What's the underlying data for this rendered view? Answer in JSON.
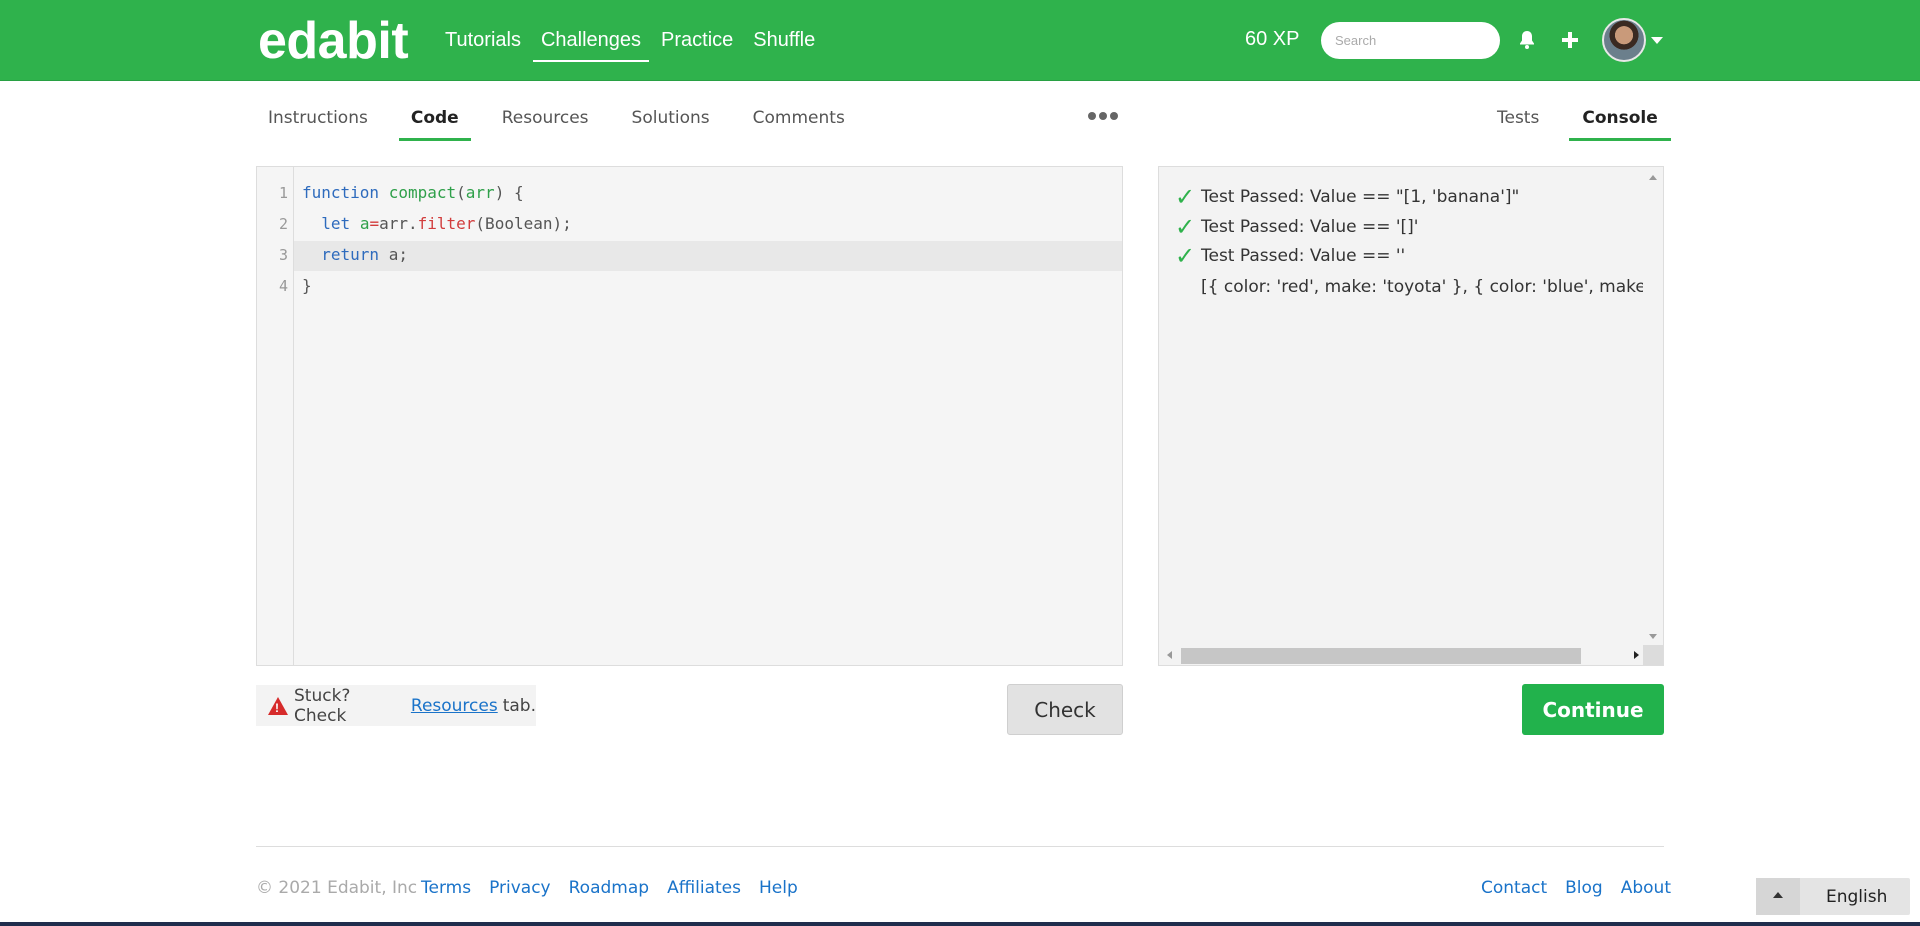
{
  "header": {
    "logo": "edabit",
    "nav": [
      "Tutorials",
      "Challenges",
      "Practice",
      "Shuffle"
    ],
    "active_nav": "Challenges",
    "xp": "60 XP",
    "search_placeholder": "Search"
  },
  "tabs": {
    "left": [
      "Instructions",
      "Code",
      "Resources",
      "Solutions",
      "Comments"
    ],
    "active_left": "Code",
    "right": [
      "Tests",
      "Console"
    ],
    "active_right": "Console"
  },
  "editor": {
    "line_numbers": [
      "1",
      "2",
      "3",
      "4"
    ],
    "line1": {
      "kw": "function",
      "fn": "compact",
      "args": "(",
      "arg": "arr",
      "rest": ") {"
    },
    "line2": {
      "indent": "  ",
      "kw": "let",
      "var": "a",
      "op": "=",
      "obj": "arr.",
      "method": "filter",
      "rest": "(Boolean);"
    },
    "line3": {
      "indent": "  ",
      "kw": "return",
      "rest": " a;"
    },
    "line4": "}"
  },
  "console": {
    "results": [
      "Test Passed: Value == \"[1, 'banana']\"",
      "Test Passed: Value == '[]'",
      "Test Passed: Value == ''"
    ],
    "continuation": "[{ color: 'red', make: 'toyota' }, { color: 'blue', make: 'maz"
  },
  "footer_actions": {
    "stuck_prefix": "Stuck? Check",
    "stuck_link": "Resources",
    "stuck_suffix": "tab.",
    "check": "Check",
    "continue": "Continue"
  },
  "footer": {
    "copyright": "© 2021 Edabit, Inc",
    "links_left": [
      "Terms",
      "Privacy",
      "Roadmap",
      "Affiliates",
      "Help"
    ],
    "links_right": [
      "Contact",
      "Blog",
      "About"
    ],
    "language": "English"
  },
  "colors": {
    "brand_green": "#2fb24c",
    "link_blue": "#1a73c9",
    "warning_red": "#d62b2b"
  }
}
